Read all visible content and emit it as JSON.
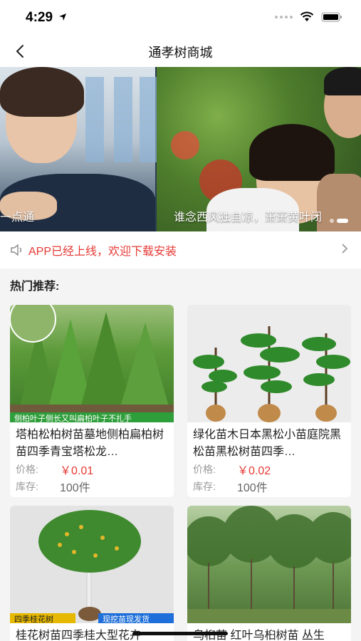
{
  "status": {
    "time": "4:29"
  },
  "nav": {
    "title": "通孝树商城"
  },
  "banner": {
    "slides": [
      {
        "caption": "一点通"
      },
      {
        "caption": "谁念西风独自凉，萧萧黄叶闭"
      }
    ]
  },
  "notice": {
    "text": "APP已经上线，欢迎下载安装"
  },
  "section": {
    "title": "热门推荐:"
  },
  "labels": {
    "price": "价格:",
    "stock": "库存:"
  },
  "products": [
    {
      "title": "塔柏松柏树苗墓地侧柏扁柏树苗四季青宝塔松龙…",
      "price": "￥0.01",
      "stock": "100件",
      "tag": "侧柏叶子侧长又叫扁柏叶子不扎手"
    },
    {
      "title": "绿化苗木日本黑松小苗庭院黑松苗黑松树苗四季…",
      "price": "￥0.02",
      "stock": "100件",
      "tag": ""
    },
    {
      "title": "桂花树苗四季桂大型花卉",
      "price": "",
      "stock": "",
      "tag": "四季桂花树",
      "tag2": "现挖苗现发货"
    },
    {
      "title": "乌桕苗 红叶乌桕树苗 丛生",
      "price": "",
      "stock": "",
      "tag": ""
    }
  ],
  "colors": {
    "accent": "#e53935",
    "background": "#f4f4f4"
  }
}
